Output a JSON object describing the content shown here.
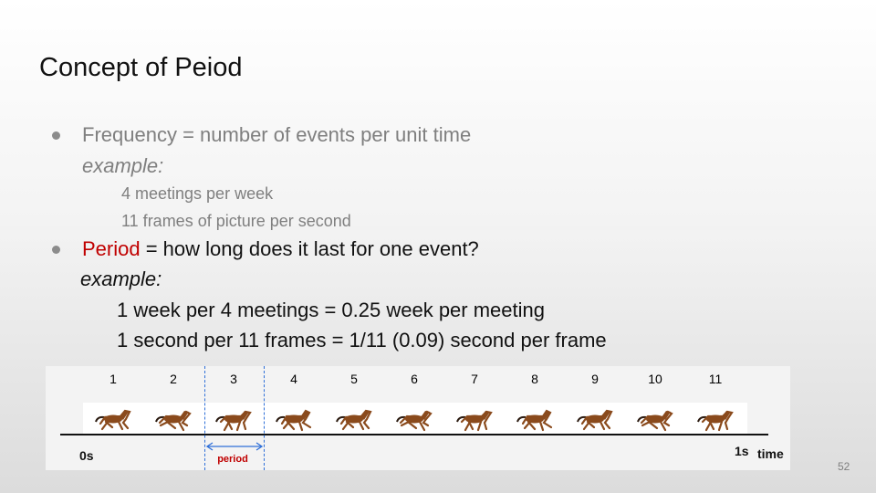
{
  "slide": {
    "title": "Concept of Peiod",
    "page_number": "52"
  },
  "frequency": {
    "term": "Frequency",
    "definition": "= number of events per unit time",
    "example_label": "example:",
    "examples": [
      "4 meetings per week",
      "11 frames of picture per second"
    ]
  },
  "period": {
    "term": "Period",
    "definition": "= how long does it last for one event?",
    "example_label": "example:",
    "examples": [
      "1 week per 4 meetings = 0.25 week per meeting",
      "1 second per 11 frames = 1/11 (0.09) second per frame"
    ]
  },
  "figure": {
    "frame_numbers": [
      "1",
      "2",
      "3",
      "4",
      "5",
      "6",
      "7",
      "8",
      "9",
      "10",
      "11"
    ],
    "start_label": "0s",
    "end_label": "1s",
    "axis_label": "time",
    "period_label": "period",
    "colors": {
      "horse": "#8a4a1c",
      "period_marker": "#2e6fd8",
      "highlight": "#c00000"
    }
  }
}
